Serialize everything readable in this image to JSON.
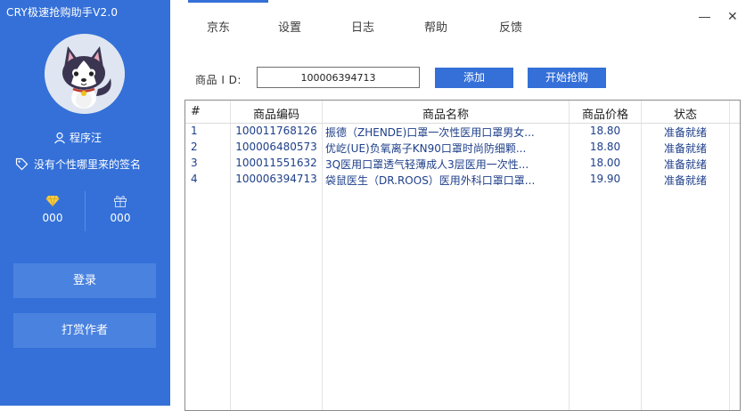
{
  "app": {
    "title": "CRY极速抢购助手V2.0"
  },
  "colors": {
    "sidebar": "#3470d8",
    "button": "#3470d8",
    "side_button": "#4a82df",
    "row_text": "#1e3f8a"
  },
  "user": {
    "name": "程序汪",
    "signature": "没有个性哪里来的签名"
  },
  "stats": [
    {
      "icon": "diamond-icon",
      "value": "000"
    },
    {
      "icon": "gift-icon",
      "value": "000"
    }
  ],
  "sidebar": {
    "login_label": "登录",
    "tip_label": "打赏作者"
  },
  "tabs": [
    {
      "label": "京东"
    },
    {
      "label": "设置"
    },
    {
      "label": "日志"
    },
    {
      "label": "帮助"
    },
    {
      "label": "反馈"
    }
  ],
  "window": {
    "minimize": "—",
    "close": "✕"
  },
  "toolbar": {
    "id_label": "商品 I D:",
    "id_value": "100006394713",
    "add_label": "添加",
    "start_label": "开始抢购"
  },
  "table": {
    "headers": [
      "#",
      "商品编码",
      "商品名称",
      "商品价格",
      "状态"
    ],
    "rows": [
      {
        "num": "1",
        "code": "100011768126",
        "name": "振德（ZHENDE)口罩一次性医用口罩男女...",
        "price": "18.80",
        "status": "准备就绪"
      },
      {
        "num": "2",
        "code": "100006480573",
        "name": "优屹(UE)负氧离子KN90口罩时尚防细颗...",
        "price": "18.80",
        "status": "准备就绪"
      },
      {
        "num": "3",
        "code": "100011551632",
        "name": "3Q医用口罩透气轻薄成人3层医用一次性...",
        "price": "18.00",
        "status": "准备就绪"
      },
      {
        "num": "4",
        "code": "100006394713",
        "name": "袋鼠医生（DR.ROOS）医用外科口罩口罩...",
        "price": "19.90",
        "status": "准备就绪"
      }
    ]
  }
}
